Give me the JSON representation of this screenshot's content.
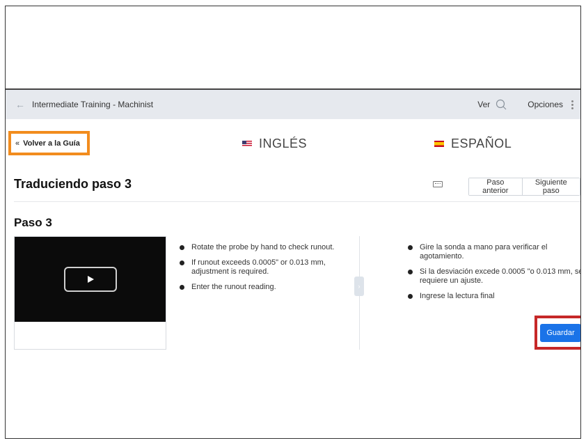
{
  "topbar": {
    "back_label": "Intermediate Training - Machinist",
    "ver_label": "Ver",
    "options_label": "Opciones"
  },
  "nav": {
    "back_to_guide": "Volver a la Guía"
  },
  "languages": {
    "source": "INGLÉS",
    "target": "ESPAÑOL"
  },
  "header": {
    "title": "Traduciendo paso 3",
    "prev_step": "Paso anterior",
    "next_step": "Siguiente paso"
  },
  "step": {
    "title": "Paso 3",
    "english_bullets": [
      "Rotate the probe by hand to check runout.",
      "If runout exceeds 0.0005\" or 0.013 mm, adjustment is required.",
      "Enter the runout reading."
    ],
    "spanish_bullets": [
      "Gire la sonda a mano para verificar el agotamiento.",
      "Si la desviación excede 0.0005 \"o 0.013 mm, se requiere un ajuste.",
      "Ingrese la lectura final"
    ],
    "save_label": "Guardar"
  },
  "colors": {
    "highlight_orange": "#f28c1e",
    "highlight_red": "#c62828",
    "primary_blue": "#1a73e8",
    "topbar_bg": "#e6e9ee"
  },
  "icons": [
    "back-arrow-icon",
    "search-icon",
    "kebab-menu-icon",
    "chevron-double-left-icon",
    "us-flag-icon",
    "spain-flag-icon",
    "keyboard-icon",
    "play-icon",
    "arrow-right-icon"
  ]
}
